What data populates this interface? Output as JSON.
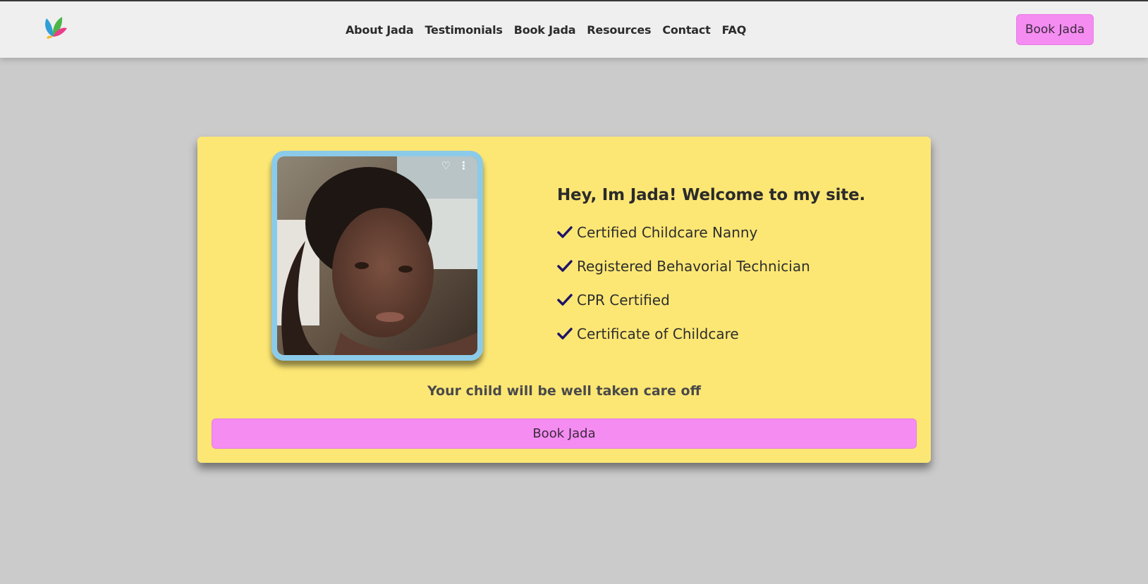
{
  "nav": {
    "logo_icon": "leaf-logo-icon",
    "links": [
      "About Jada",
      "Testimonials",
      "Book Jada",
      "Resources",
      "Contact",
      "FAQ"
    ],
    "cta_label": "Book Jada"
  },
  "hero": {
    "photo_alt": "Portrait of Jada",
    "heading": "Hey, Im Jada! Welcome to my site.",
    "credentials": [
      "Certified Childcare Nanny",
      "Registered Behavorial Technician",
      "CPR Certified",
      "Certificate of Childcare"
    ],
    "tagline": "Your child will be well taken care off",
    "cta_label": "Book Jada"
  },
  "colors": {
    "page_bg": "#cbcbcb",
    "header_bg": "#efefef",
    "card_bg": "#fde774",
    "button_bg": "#f58cf2",
    "photo_border": "#8bcbe9",
    "check": "#1e1268"
  }
}
